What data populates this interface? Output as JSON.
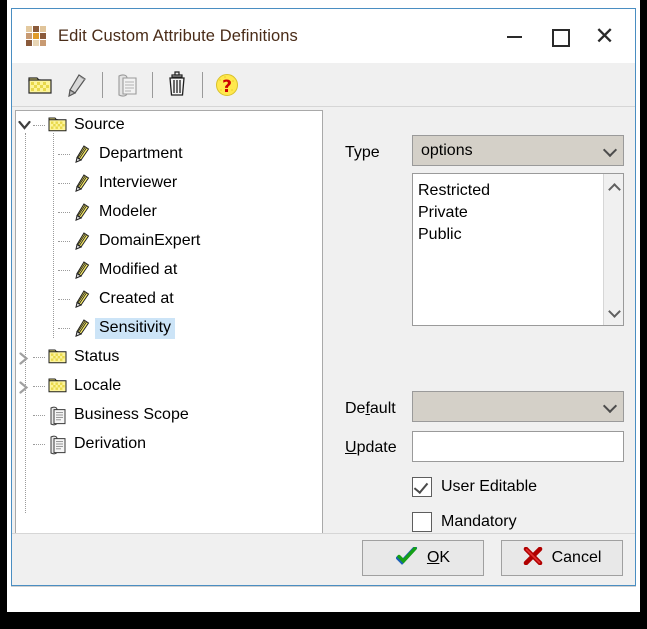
{
  "window": {
    "title": "Edit Custom Attribute Definitions",
    "icon": "grid-squares-icon",
    "icon_colors": [
      "#e3c99f",
      "#8a5a3b",
      "#e0c49a",
      "#c89a72",
      "#e09b2a",
      "#8a5a3b",
      "#8a5a3b",
      "#e8d6b6",
      "#c89a72"
    ],
    "controls": {
      "minimize": "—",
      "maximize": "□",
      "close": "✕"
    }
  },
  "toolbar": {
    "buttons": [
      {
        "name": "open-folder-icon",
        "tooltip": "New"
      },
      {
        "name": "pencil-icon",
        "tooltip": "Rename"
      },
      {
        "name": "document-copy-icon",
        "tooltip": "Copy definition"
      },
      {
        "name": "trash-icon",
        "tooltip": "Delete"
      },
      {
        "name": "help-question-icon",
        "tooltip": "Help"
      }
    ]
  },
  "tree": {
    "nodes": [
      {
        "label": "Source",
        "depth": 0,
        "icon": "folder-icon",
        "twist": "expanded",
        "selected": false
      },
      {
        "label": "Department",
        "depth": 1,
        "icon": "pencil-icon",
        "twist": "none",
        "selected": false
      },
      {
        "label": "Interviewer",
        "depth": 1,
        "icon": "pencil-icon",
        "twist": "none",
        "selected": false
      },
      {
        "label": "Modeler",
        "depth": 1,
        "icon": "pencil-icon",
        "twist": "none",
        "selected": false
      },
      {
        "label": "DomainExpert",
        "depth": 1,
        "icon": "pencil-icon",
        "twist": "none",
        "selected": false
      },
      {
        "label": "Modified at",
        "depth": 1,
        "icon": "pencil-icon",
        "twist": "none",
        "selected": false
      },
      {
        "label": "Created at",
        "depth": 1,
        "icon": "pencil-icon",
        "twist": "none",
        "selected": false
      },
      {
        "label": "Sensitivity",
        "depth": 1,
        "icon": "pencil-icon",
        "twist": "none",
        "selected": true
      },
      {
        "label": "Status",
        "depth": 0,
        "icon": "folder-icon",
        "twist": "collapsed",
        "selected": false
      },
      {
        "label": "Locale",
        "depth": 0,
        "icon": "folder-icon",
        "twist": "collapsed",
        "selected": false
      },
      {
        "label": "Business Scope",
        "depth": 0,
        "icon": "document-copy-icon",
        "twist": "leaf",
        "selected": false
      },
      {
        "label": "Derivation",
        "depth": 0,
        "icon": "document-copy-icon",
        "twist": "leaf",
        "selected": false
      }
    ]
  },
  "properties": {
    "type_label": "Type",
    "type_value": "options",
    "options_list": [
      "Restricted",
      "Private",
      "Public"
    ],
    "default_label_pre": "De",
    "default_label_accel": "f",
    "default_label_post": "ault",
    "default_value": "",
    "update_label_accel": "U",
    "update_label_post": "pdate",
    "update_value": "",
    "checkboxes": [
      {
        "label": "User Editable",
        "checked": true
      },
      {
        "label": "Mandatory",
        "checked": false
      }
    ]
  },
  "footer": {
    "ok_accel": "O",
    "ok_post": "K",
    "cancel_label": "Cancel"
  },
  "colors": {
    "dialog_bg": "#f0f0f0",
    "window_border": "#4a8ec2",
    "selection": "#cce4f7",
    "combo_bg": "#d4d0c8",
    "title_text": "#4a2c18",
    "ok_check": "#149414",
    "cancel_x": "#c00000"
  }
}
